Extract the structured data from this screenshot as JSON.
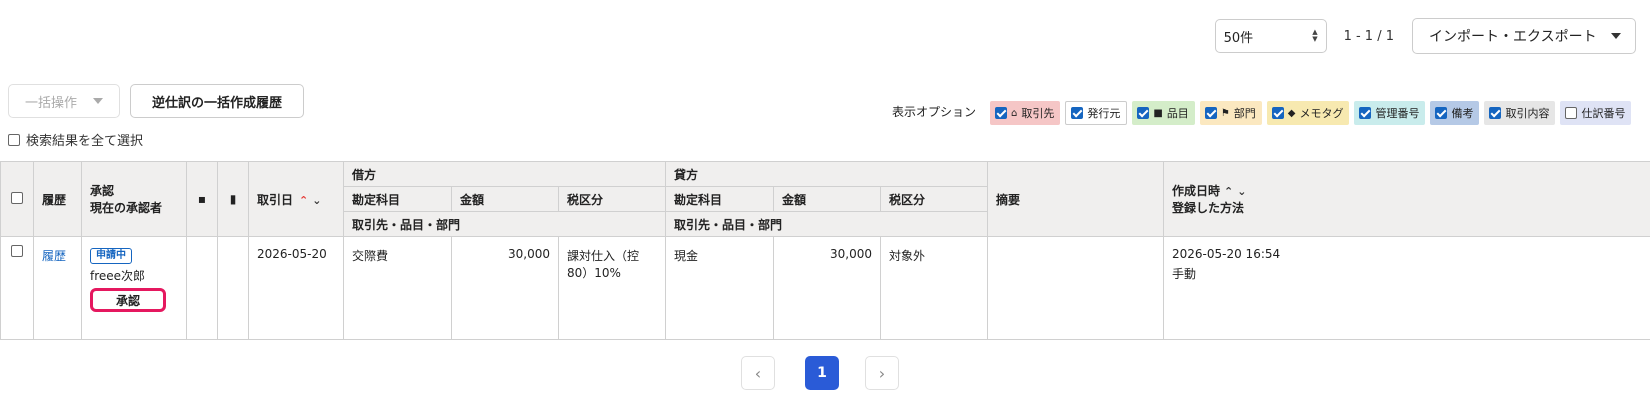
{
  "topbar": {
    "per_page": "50件",
    "range": "1 - 1 / 1",
    "import_export": "インポート・エクスポート"
  },
  "actions": {
    "bulk": "一括操作",
    "reverse_history": "逆仕訳の一括作成履歴",
    "select_all": "検索結果を全て選択"
  },
  "display_options": {
    "label": "表示オプション",
    "chips": [
      {
        "label": "取引先",
        "icon": "home-icon",
        "checked": true,
        "bg": "#f5c6c6"
      },
      {
        "label": "発行元",
        "icon": "",
        "checked": true,
        "bg": "#ffffff"
      },
      {
        "label": "品目",
        "icon": "briefcase-icon",
        "checked": true,
        "bg": "#d4edc9"
      },
      {
        "label": "部門",
        "icon": "flag-icon",
        "checked": true,
        "bg": "#fbe8c0"
      },
      {
        "label": "メモタグ",
        "icon": "tag-icon",
        "checked": true,
        "bg": "#f7e9b0"
      },
      {
        "label": "管理番号",
        "icon": "",
        "checked": true,
        "bg": "#c9ecec"
      },
      {
        "label": "備考",
        "icon": "",
        "checked": true,
        "bg": "#b5c9e6"
      },
      {
        "label": "取引内容",
        "icon": "",
        "checked": true,
        "bg": "#e6e6e6"
      },
      {
        "label": "仕訳番号",
        "icon": "",
        "checked": false,
        "bg": "#dfe3f5"
      }
    ]
  },
  "table": {
    "headers": {
      "history": "履歴",
      "approval_1": "承認",
      "approval_2": "現在の承認者",
      "date": "取引日",
      "debit": "借方",
      "credit": "貸方",
      "account": "勘定科目",
      "amount": "金額",
      "tax": "税区分",
      "partner_item_dept": "取引先・品目・部門",
      "summary": "摘要",
      "created_1": "作成日時",
      "created_2": "登録した方法"
    },
    "rows": [
      {
        "history_link": "履歴",
        "status": "申請中",
        "approver": "freee次郎",
        "approve_button": "承認",
        "date": "2026-05-20",
        "debit_account": "交際費",
        "debit_amount": "30,000",
        "debit_tax": "課対仕入（控80）10%",
        "credit_account": "現金",
        "credit_amount": "30,000",
        "credit_tax": "対象外",
        "summary": "",
        "created_at": "2026-05-20 16:54",
        "method": "手動"
      }
    ]
  },
  "pagination": {
    "current": "1",
    "prev": "‹",
    "next": "›"
  },
  "colors": {
    "accent": "#2a5bd7",
    "highlight": "#e5185f",
    "link": "#1565c0"
  }
}
